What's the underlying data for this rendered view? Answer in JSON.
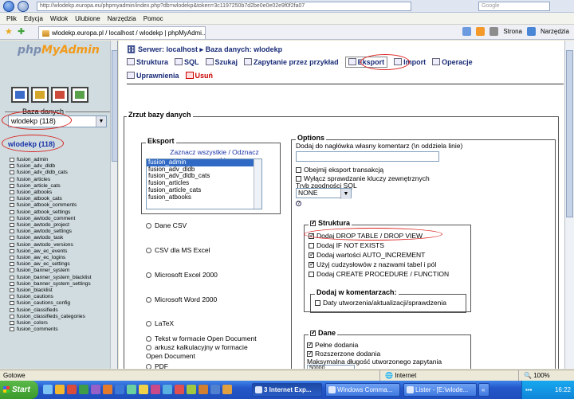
{
  "browser": {
    "address": "http://wlodekp.europa.eu/phpmyadmin/index.php?db=wlodekp&token=3c1197250b7d2be0e0e02e9f0f2fa07",
    "search_placeholder": "Google",
    "menu": [
      "Plik",
      "Edycja",
      "Widok",
      "Ulubione",
      "Narzędzia",
      "Pomoc"
    ],
    "tab_title": "wlodekp.europa.pl / localhost / wlodekp | phpMyAdmi...",
    "tools": {
      "strona": "Strona",
      "narzedzia": "Narzędzia"
    }
  },
  "left": {
    "logo_php": "php",
    "logo_ma": "MyAdmin",
    "db_label": "Baza danych",
    "db_select": "wlodekp (118)",
    "db_link": "wlodekp (118)",
    "tables": [
      "fusion_admin",
      "fusion_adv_dldb",
      "fusion_adv_dldb_cats",
      "fusion_articles",
      "fusion_article_cats",
      "fusion_atbooks",
      "fusion_atbook_cats",
      "fusion_atbook_comments",
      "fusion_atbook_settings",
      "fusion_awtodo_comment",
      "fusion_awtodo_project",
      "fusion_awtodo_settings",
      "fusion_awtodo_task",
      "fusion_awtodo_versions",
      "fusion_aw_ec_events",
      "fusion_aw_ec_logins",
      "fusion_aw_ec_settings",
      "fusion_banner_system",
      "fusion_banner_system_blacklist",
      "fusion_banner_system_settings",
      "fusion_blacklist",
      "fusion_cautions",
      "fusion_cautions_config",
      "fusion_classifieds",
      "fusion_classifieds_categories",
      "fusion_colors",
      "fusion_comments"
    ]
  },
  "main": {
    "server_prefix": "Serwer:",
    "server": "localhost",
    "db_prefix": "Baza danych:",
    "db": "wlodekp",
    "tabs": {
      "struktura": "Struktura",
      "sql": "SQL",
      "szukaj": "Szukaj",
      "zapytanie": "Zapytanie przez przykład",
      "eksport": "Eksport",
      "import": "Import",
      "operacje": "Operacje",
      "uprawnienia": "Uprawnienia",
      "usun": "Usuń"
    },
    "dump_legend": "Zrzut bazy danych",
    "eksport_legend": "Eksport",
    "select_all_line1": "Zaznacz wszystkie / Odznacz",
    "select_all_line2": "wszystkie",
    "export_tables": [
      "fusion_admin",
      "fusion_adv_dldb",
      "fusion_adv_dldb_cats",
      "fusion_articles",
      "fusion_article_cats",
      "fusion_atbooks"
    ],
    "formats": [
      "Dane CSV",
      "CSV dla MS Excel",
      "Microsoft Excel 2000",
      "Microsoft Word 2000",
      "LaTeX",
      "arkusz kalkulacyjny w formacie",
      "Open Document",
      "Tekst w formacie Open Document",
      "PDF"
    ],
    "options": {
      "legend": "Options",
      "comment_label": "Dodaj do nagłówka własny komentarz (\\n oddziela linie)",
      "transaction": "Obejmij eksport transakcją",
      "fk_checks": "Wyłącz sprawdzanie kluczy zewnętrznych",
      "compat_label": "Tryb zgodności SQL",
      "compat_value": "NONE",
      "help": "?"
    },
    "struktura": {
      "legend": "Struktura",
      "drop": "Dodaj DROP TABLE / DROP VIEW",
      "if_not_exists": "Dodaj IF NOT EXISTS",
      "auto_inc": "Dodaj wartości AUTO_INCREMENT",
      "backquotes": "Użyj cudzysłowów z nazwami tabel i pól",
      "procedure": "Dodaj CREATE PROCEDURE / FUNCTION"
    },
    "komentarze": {
      "legend": "Dodaj w komentarzach:",
      "dates": "Daty utworzenia/aktualizacji/sprawdzenia"
    },
    "dane": {
      "legend": "Dane",
      "complete": "Pełne dodania",
      "extended": "Rozszerzone dodania",
      "maxlen_label": "Maksymalna długość utworzonego zapytania",
      "maxlen_value": "50000"
    }
  },
  "status": {
    "text": "Gotowe",
    "zone": "Internet",
    "zoom": "100%"
  },
  "taskbar": {
    "start": "Start",
    "tasks": [
      "3 Internet Exp...",
      "Windows Comma...",
      "Lister - [E:\\wlode...",
      "«"
    ],
    "clock": "16:22"
  }
}
